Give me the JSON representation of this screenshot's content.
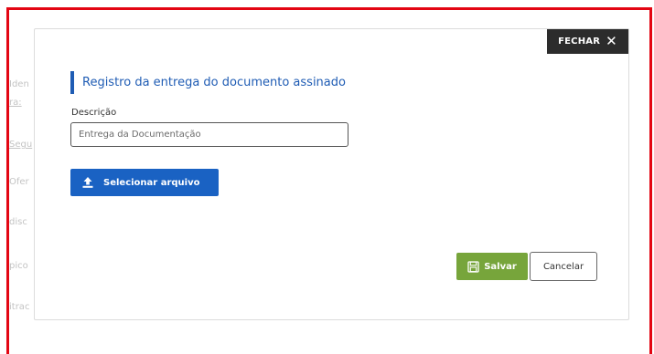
{
  "background": {
    "fragments": [
      {
        "text": "Iden",
        "underlined": false
      },
      {
        "text": "ra:",
        "underlined": true
      },
      {
        "text": "Segu",
        "underlined": true
      },
      {
        "text": "Ofer",
        "underlined": false
      },
      {
        "text": "disc",
        "underlined": false
      },
      {
        "text": "pico",
        "underlined": false
      },
      {
        "text": "itrac",
        "underlined": false
      }
    ]
  },
  "modal": {
    "close_label": "FECHAR",
    "close_icon": "✕",
    "title": "Registro da entrega do documento assinado",
    "description": {
      "label": "Descrição",
      "value": "Entrega da Documentação"
    },
    "upload_label": "Selecionar arquivo",
    "save_label": "Salvar",
    "cancel_label": "Cancelar"
  },
  "colors": {
    "frame_border": "#e30613",
    "title": "#1f5cb4",
    "upload_button": "#1a62c3",
    "save_button": "#77a53b",
    "close_button": "#2c2c2c"
  }
}
